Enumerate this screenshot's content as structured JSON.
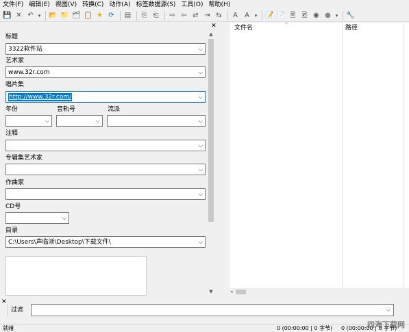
{
  "menu": [
    "文件(F)",
    "编辑(E)",
    "视图(V)",
    "转换(C)",
    "动作(A)",
    "标签数据源(S)",
    "工具(O)",
    "帮助(H)"
  ],
  "toolbar_icons": [
    {
      "name": "save-icon",
      "glyph": "💾"
    },
    {
      "name": "delete-icon",
      "glyph": "✕"
    },
    {
      "name": "undo-icon",
      "glyph": "↶"
    },
    {
      "name": "undo-dropdown-icon",
      "glyph": "▾"
    },
    {
      "name": "open-directory-icon",
      "glyph": "📂"
    },
    {
      "name": "browse-folder-icon",
      "glyph": "📁"
    },
    {
      "name": "favorite-folder-icon",
      "glyph": "🗂"
    },
    {
      "name": "playlist-icon",
      "glyph": "📋"
    },
    {
      "name": "star-icon",
      "glyph": "★"
    },
    {
      "name": "refresh-icon",
      "glyph": "⟳"
    },
    {
      "name": "select-all-icon",
      "glyph": "▤"
    },
    {
      "name": "copy-tag-icon",
      "glyph": "⎘"
    },
    {
      "name": "paste-tag-icon",
      "glyph": "⎗"
    },
    {
      "name": "tag-to-filename-icon",
      "glyph": "⇨"
    },
    {
      "name": "filename-to-tag-icon",
      "glyph": "⇦"
    },
    {
      "name": "tag-to-tag-icon",
      "glyph": "⇄"
    },
    {
      "name": "text-file-to-tag-icon",
      "glyph": "⇥"
    },
    {
      "name": "filename-to-filename-icon",
      "glyph": "⇆"
    },
    {
      "name": "case-convert-icon",
      "glyph": "A"
    },
    {
      "name": "quick-action-icon",
      "glyph": "A"
    },
    {
      "name": "action-dropdown-icon",
      "glyph": "▾"
    },
    {
      "name": "export-icon",
      "glyph": "📝"
    },
    {
      "name": "document-icon",
      "glyph": "📄"
    },
    {
      "name": "playlist-export-icon",
      "glyph": "🖹"
    },
    {
      "name": "preview-icon",
      "glyph": "🖻"
    },
    {
      "name": "disc-icon",
      "glyph": "◉"
    },
    {
      "name": "web-source-icon",
      "glyph": "●"
    },
    {
      "name": "web-source-dropdown-icon",
      "glyph": "▾"
    },
    {
      "name": "tools-icon",
      "glyph": "🔧"
    }
  ],
  "left": {
    "fields": {
      "title": {
        "label": "标题",
        "value": "3322软件站"
      },
      "artist": {
        "label": "艺术家",
        "value": "www.32r.com"
      },
      "album": {
        "label": "唱片集",
        "value": "http://www.32r.com/"
      },
      "year": {
        "label": "年份",
        "value": ""
      },
      "track": {
        "label": "音轨号",
        "value": ""
      },
      "genre": {
        "label": "流派",
        "value": ""
      },
      "comment": {
        "label": "注释",
        "value": ""
      },
      "album_artist": {
        "label": "专辑集艺术家",
        "value": ""
      },
      "composer": {
        "label": "作曲家",
        "value": ""
      },
      "disc": {
        "label": "CD号",
        "value": ""
      },
      "directory": {
        "label": "目录",
        "value": "C:\\Users\\声临淅\\Desktop\\下载文件\\"
      }
    }
  },
  "right": {
    "columns": [
      "文件名",
      "路径"
    ]
  },
  "filter": {
    "label": "过滤",
    "value": ""
  },
  "status": {
    "ready": "就绪",
    "selected": "0 (00:00:00 | 0 字节)",
    "total": "0 (00:00:00 | 0 字节)"
  },
  "watermark": "四海下载网"
}
